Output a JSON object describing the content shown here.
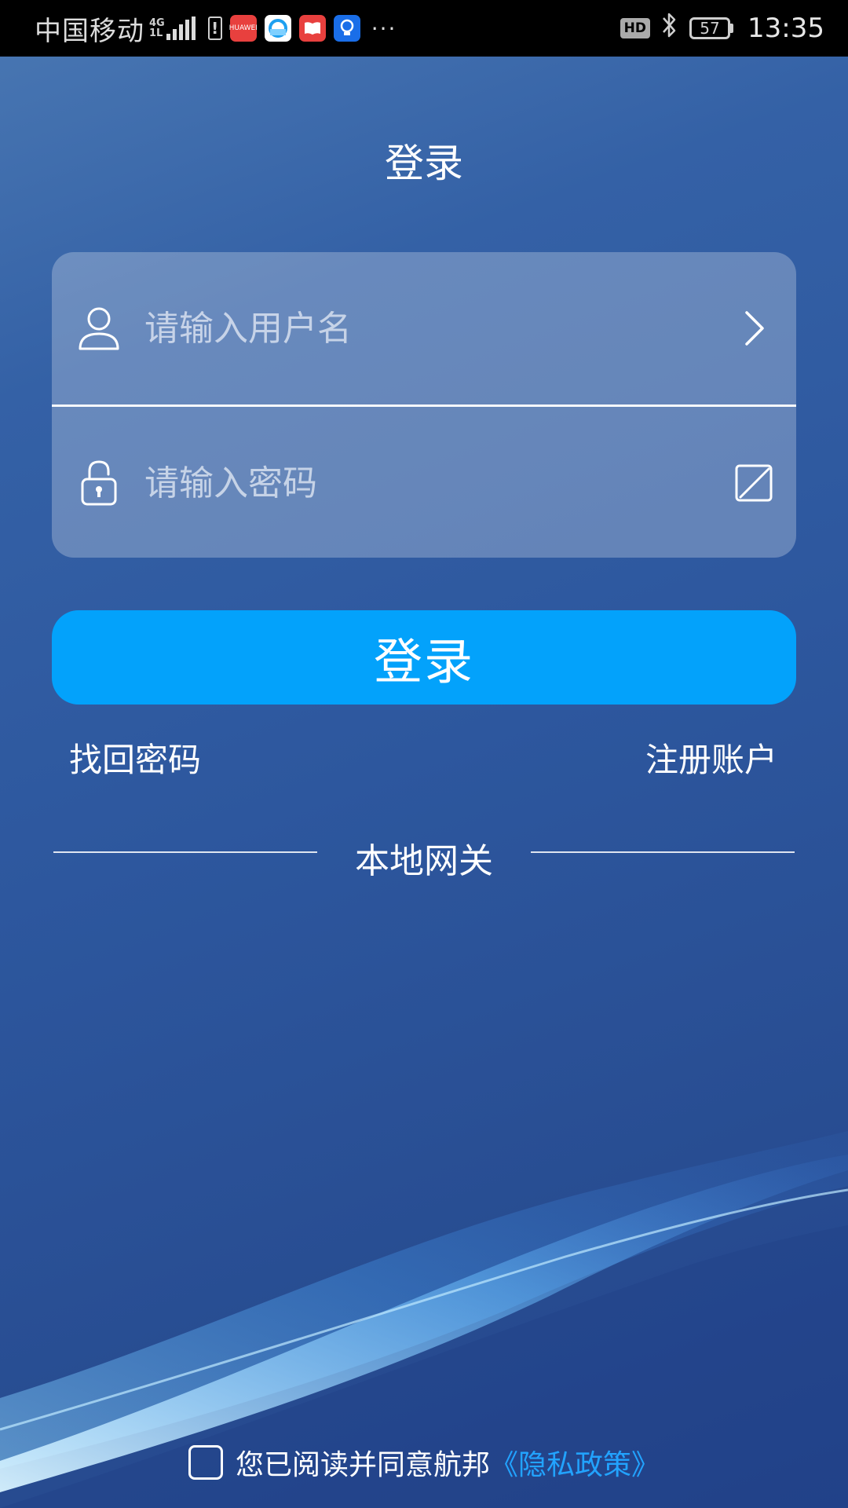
{
  "status_bar": {
    "carrier": "中国移动",
    "network_top": "4G",
    "network_bottom": "1L",
    "warn": "!",
    "app_icons": [
      {
        "name": "huawei-appgallery-icon",
        "label": "HUAWEI",
        "color": "#e8403e"
      },
      {
        "name": "browser-icon",
        "label": "",
        "color": "#ffffff"
      },
      {
        "name": "books-icon",
        "label": "",
        "color": "#e8403e"
      },
      {
        "name": "tips-icon",
        "label": "",
        "color": "#1a6ee8"
      }
    ],
    "more": "···",
    "hd": "HD",
    "battery": "57",
    "time": "13:35"
  },
  "page": {
    "title": "登录"
  },
  "form": {
    "username_placeholder": "请输入用户名",
    "username_value": "",
    "password_placeholder": "请输入密码",
    "password_value": ""
  },
  "actions": {
    "login_label": "登录",
    "forgot_label": "找回密码",
    "register_label": "注册账户"
  },
  "gateway": {
    "label": "本地网关"
  },
  "agreement": {
    "checked": false,
    "text": "您已阅读并同意航邦",
    "policy_link": "《隐私政策》"
  },
  "colors": {
    "accent": "#03a2fb",
    "link": "#22a3ff",
    "background": "#2d579e"
  }
}
